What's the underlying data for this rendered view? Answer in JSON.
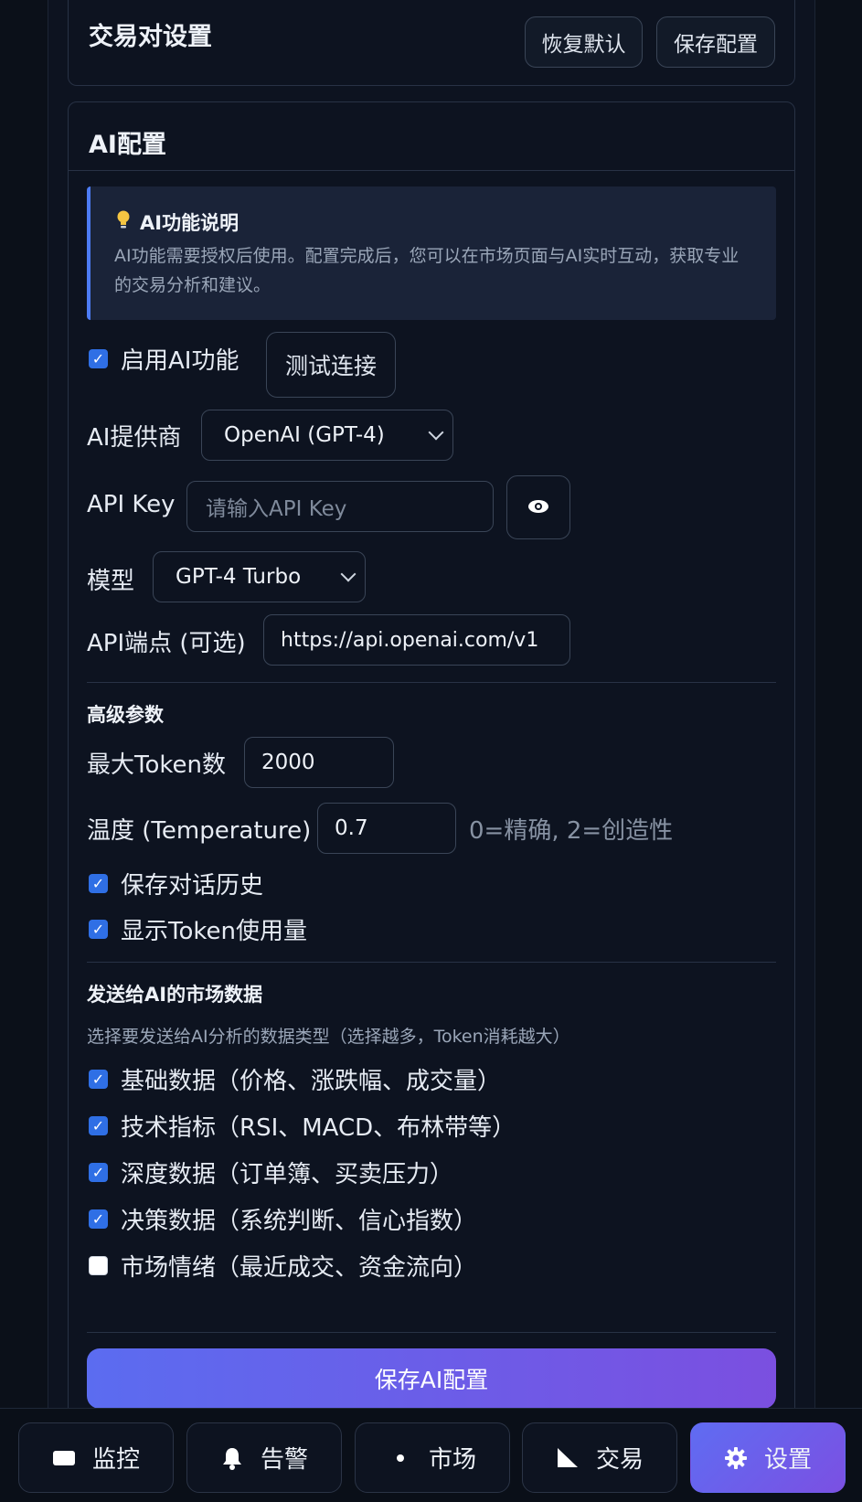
{
  "pair_settings": {
    "title": "交易对设置",
    "restore_label": "恢复默认",
    "save_label": "保存配置"
  },
  "ai_config": {
    "title": "AI配置",
    "info_title": "AI功能说明",
    "info_text": "AI功能需要授权后使用。配置完成后，您可以在市场页面与AI实时互动，获取专业的交易分析和建议。",
    "enable_label": "启用AI功能",
    "test_label": "测试连接",
    "provider_label": "AI提供商",
    "provider_value": "OpenAI (GPT-4)",
    "apikey_label": "API Key",
    "apikey_placeholder": "请输入API Key",
    "model_label": "模型",
    "model_value": "GPT-4 Turbo",
    "endpoint_label": "API端点 (可选)",
    "endpoint_value": "https://api.openai.com/v1",
    "advanced_title": "高级参数",
    "max_tokens_label": "最大Token数",
    "max_tokens_value": "2000",
    "temperature_label": "温度 (Temperature)",
    "temperature_value": "0.7",
    "temperature_hint": "0=精确, 2=创造性",
    "save_history_label": "保存对话历史",
    "show_token_label": "显示Token使用量",
    "market_data_title": "发送给AI的市场数据",
    "market_data_hint": "选择要发送给AI分析的数据类型（选择越多，Token消耗越大）",
    "market_options": [
      {
        "label": "基础数据（价格、涨跌幅、成交量）",
        "checked": true
      },
      {
        "label": "技术指标（RSI、MACD、布林带等）",
        "checked": true
      },
      {
        "label": "深度数据（订单簿、买卖压力）",
        "checked": true
      },
      {
        "label": "决策数据（系统判断、信心指数）",
        "checked": true
      },
      {
        "label": "市场情绪（最近成交、资金流向）",
        "checked": false
      }
    ],
    "save_ai_label": "保存AI配置"
  },
  "nav": {
    "monitor": "监控",
    "alerts": "告警",
    "market": "市场",
    "trade": "交易",
    "settings": "设置"
  },
  "colors": {
    "accent": "#5b6cf0",
    "accent2": "#7b4fe0",
    "background": "#0d1320",
    "checkbox": "#2f6fe5"
  }
}
